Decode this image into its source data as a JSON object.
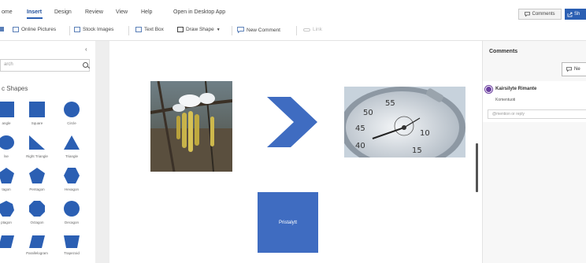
{
  "ribbon": {
    "tabs": [
      {
        "label": "ome"
      },
      {
        "label": "Insert"
      },
      {
        "label": "Design"
      },
      {
        "label": "Review"
      },
      {
        "label": "View"
      },
      {
        "label": "Help"
      },
      {
        "label": "Open in Desktop App"
      }
    ],
    "active_tab": "Insert",
    "comments_button": "Comments",
    "share_button": "Sh",
    "accent_color": "#2b5fb3"
  },
  "toolbar": {
    "online_pictures": "Online Pictures",
    "stock_images": "Stock Images",
    "text_box": "Text Box",
    "draw_shape": "Draw Shape",
    "new_comment": "New Comment",
    "link": "Link"
  },
  "shapes_pane": {
    "search_placeholder": "arch",
    "section_title": "c Shapes",
    "shapes": [
      {
        "label": "angle",
        "icon": "rectangle-partial"
      },
      {
        "label": "Square",
        "icon": "square"
      },
      {
        "label": "Circle",
        "icon": "circle"
      },
      {
        "label": "lse",
        "icon": "ellipse-partial"
      },
      {
        "label": "Right Triangle",
        "icon": "right-triangle"
      },
      {
        "label": "Triangle",
        "icon": "triangle"
      },
      {
        "label": "tagon",
        "icon": "pentagon-partial"
      },
      {
        "label": "Pentagon",
        "icon": "pentagon"
      },
      {
        "label": "Hexagon",
        "icon": "hexagon"
      },
      {
        "label": "ptagon",
        "icon": "heptagon-partial"
      },
      {
        "label": "Octagon",
        "icon": "octagon"
      },
      {
        "label": "Decagon",
        "icon": "decagon"
      },
      {
        "label": "",
        "icon": "parallelogram-partial"
      },
      {
        "label": "Parallelogram",
        "icon": "parallelogram"
      },
      {
        "label": "Trapezoid",
        "icon": "trapezoid"
      }
    ],
    "shape_color": "#2b5fb3"
  },
  "canvas": {
    "box_label": "Pristalytt",
    "shape_color": "#3f6cc1"
  },
  "comments": {
    "title": "Comments",
    "new_button": "Ne",
    "author": "Kairsilyte Rimante",
    "text": "Komentuoti",
    "reply_placeholder": "@mention or reply"
  }
}
